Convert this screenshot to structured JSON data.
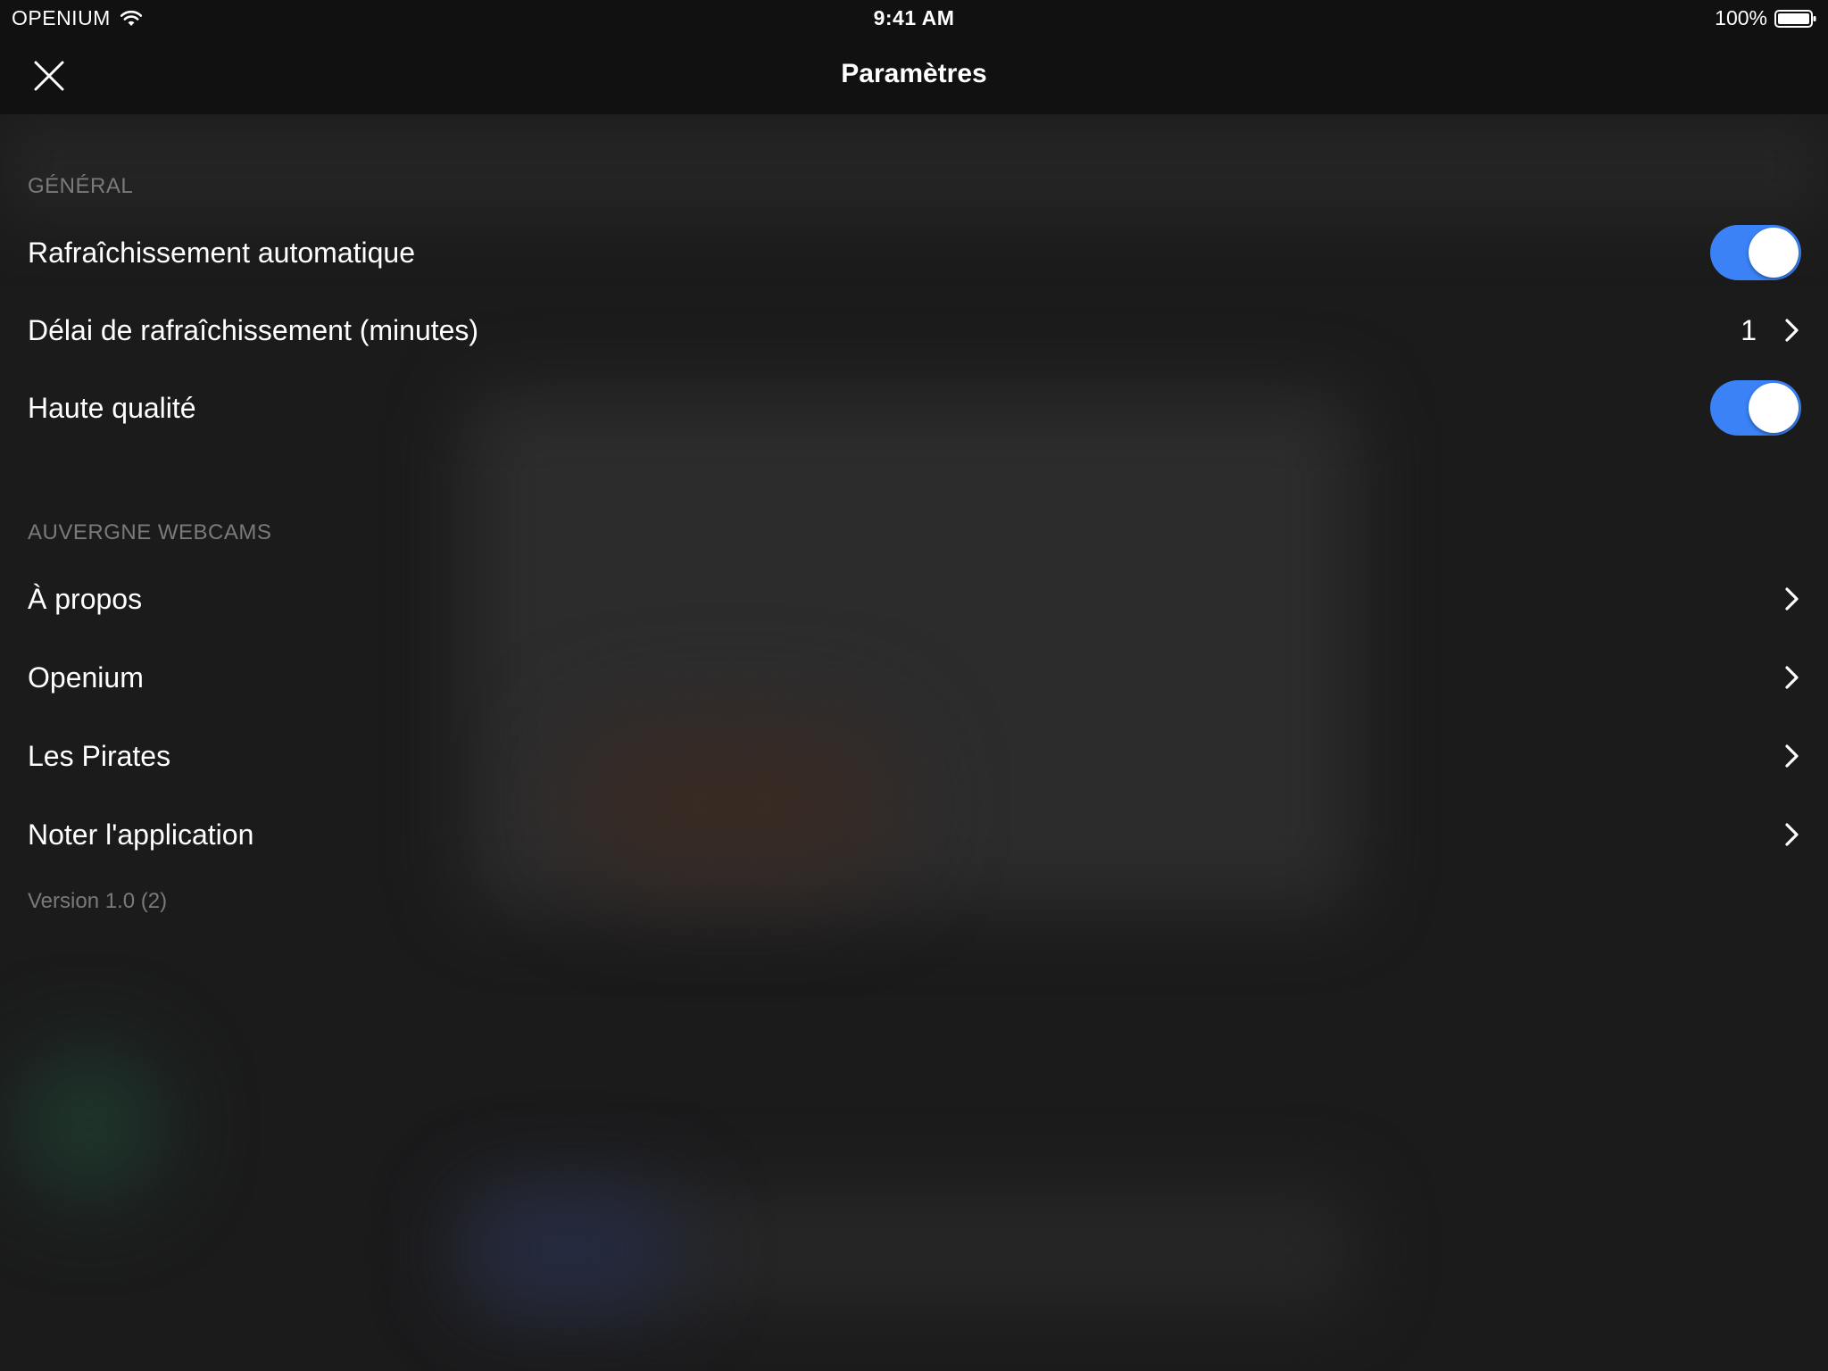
{
  "status_bar": {
    "carrier": "OPENIUM",
    "time": "9:41 AM",
    "battery": "100%"
  },
  "nav": {
    "title": "Paramètres",
    "close_icon": "close-icon"
  },
  "sections": {
    "general": {
      "header": "GÉNÉRAL",
      "auto_refresh": {
        "label": "Rafraîchissement automatique",
        "on": true
      },
      "refresh_delay": {
        "label": "Délai de rafraîchissement (minutes)",
        "value": "1"
      },
      "high_quality": {
        "label": "Haute qualité",
        "on": true
      }
    },
    "about": {
      "header": "AUVERGNE WEBCAMS",
      "items": [
        {
          "label": "À propos"
        },
        {
          "label": "Openium"
        },
        {
          "label": "Les Pirates"
        },
        {
          "label": "Noter l'application"
        }
      ]
    }
  },
  "version": "Version 1.0 (2)",
  "colors": {
    "accent": "#3a82f6",
    "background": "#1b1b1c",
    "bar": "#111112",
    "secondary_text": "#7a7a7d"
  }
}
